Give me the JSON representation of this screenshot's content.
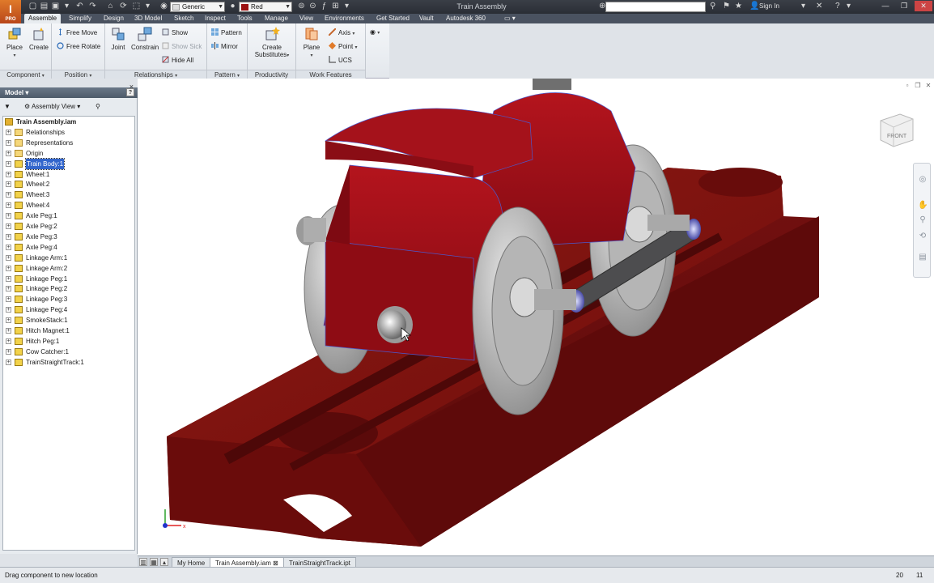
{
  "app": {
    "logo": "I",
    "logo_sub": "PRO",
    "window_title": "Train Assembly"
  },
  "quick_access": {
    "material_value": "Generic",
    "appearance_value": "Red"
  },
  "title_bar": {
    "sign_in": "Sign In"
  },
  "ribbon_tabs": [
    "Assemble",
    "Simplify",
    "Design",
    "3D Model",
    "Sketch",
    "Inspect",
    "Tools",
    "Manage",
    "View",
    "Environments",
    "Get Started",
    "Vault",
    "Autodesk 360"
  ],
  "ribbon": {
    "component": {
      "title": "Component",
      "place": "Place",
      "create": "Create"
    },
    "position": {
      "title": "Position",
      "free_move": "Free Move",
      "free_rotate": "Free Rotate"
    },
    "relationships": {
      "title": "Relationships",
      "joint": "Joint",
      "constrain": "Constrain",
      "show": "Show",
      "show_sick": "Show Sick",
      "hide_all": "Hide All"
    },
    "pattern": {
      "title": "Pattern",
      "pattern": "Pattern",
      "mirror": "Mirror"
    },
    "productivity": {
      "title": "Productivity",
      "create_line1": "Create",
      "create_line2": "Substitutes"
    },
    "work_features": {
      "title": "Work Features",
      "plane": "Plane",
      "axis": "Axis",
      "point": "Point",
      "ucs": "UCS"
    }
  },
  "browser": {
    "title": "Model",
    "help": "?",
    "view_label": "Assembly View",
    "root": "Train Assembly.iam",
    "folders": [
      "Relationships",
      "Representations",
      "Origin"
    ],
    "components": [
      "Train Body:1",
      "Wheel:1",
      "Wheel:2",
      "Wheel:3",
      "Wheel:4",
      "Axle Peg:1",
      "Axle Peg:2",
      "Axle Peg:3",
      "Axle Peg:4",
      "Linkage Arm:1",
      "Linkage Arm:2",
      "Linkage Peg:1",
      "Linkage Peg:2",
      "Linkage Peg:3",
      "Linkage Peg:4",
      "SmokeStack:1",
      "Hitch Magnet:1",
      "Hitch Peg:1",
      "Cow Catcher:1",
      "TrainStraightTrack:1"
    ],
    "selected": "Train Body:1"
  },
  "viewport": {
    "viewcube_face": "FRONT",
    "track_color": "#7a1010",
    "body_color": "#9c0f18"
  },
  "doc_tabs": {
    "home": "My Home",
    "active": "Train Assembly.iam",
    "other": "TrainStraightTrack.ipt"
  },
  "status": {
    "message": "Drag component to new location",
    "count1": "20",
    "count2": "11"
  }
}
